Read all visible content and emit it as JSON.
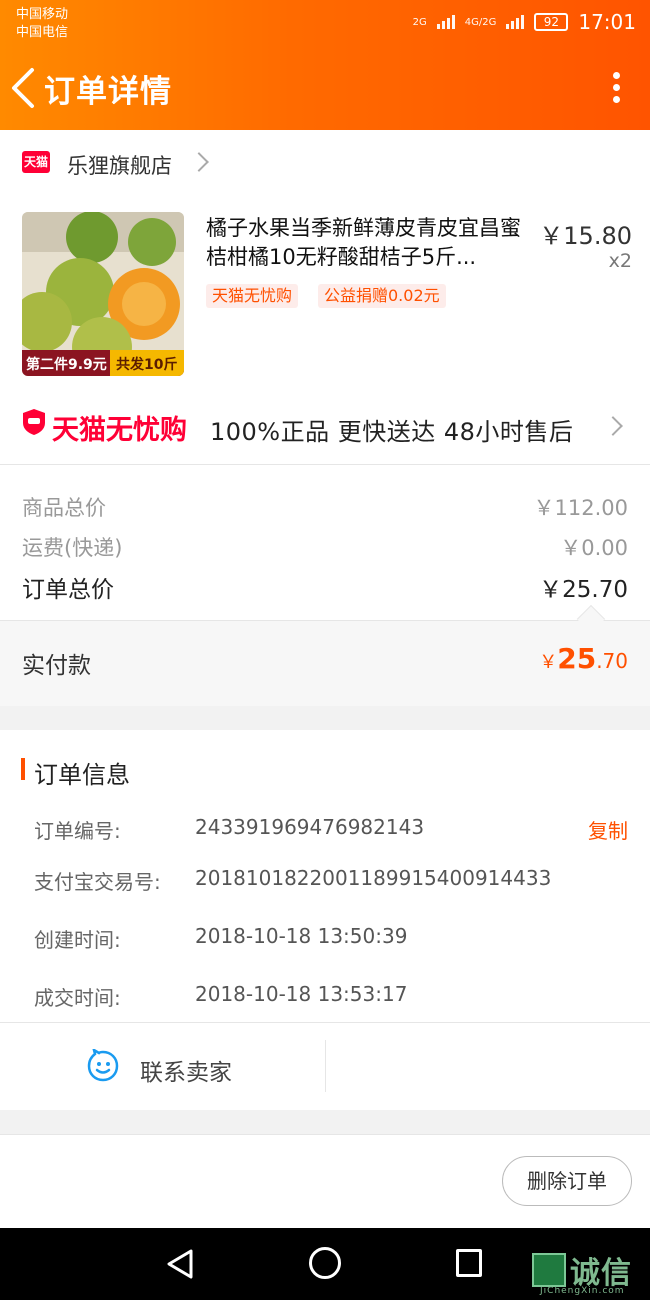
{
  "status": {
    "carrier1": "中国移动",
    "carrier2": "中国电信",
    "net1": "2G",
    "net2": "4G/2G",
    "battery": "92",
    "time": "17:01"
  },
  "header": {
    "title": "订单详情"
  },
  "shop": {
    "badge": "天猫",
    "name": "乐狸旗舰店"
  },
  "product": {
    "title": "橘子水果当季新鲜薄皮青皮宜昌蜜桔柑橘10无籽酸甜桔子5斤...",
    "price": "￥15.80",
    "qty": "x2",
    "tag1": "天猫无忧购",
    "tag2": "公益捐赠0.02元",
    "image_banner_left": "第二件9.9元",
    "image_banner_right": "共发10斤"
  },
  "assurance": {
    "brand": "天猫无忧购",
    "items": "100%正品  更快送达  48小时售后"
  },
  "totals": {
    "goods_label": "商品总价",
    "goods_value": "￥112.00",
    "shipping_label": "运费(快递)",
    "shipping_value": "￥0.00",
    "order_label": "订单总价",
    "order_value": "￥25.70",
    "paid_label": "实付款",
    "paid_yen": "￥",
    "paid_int": "25",
    "paid_dec": ".70"
  },
  "order_info": {
    "title": "订单信息",
    "order_no_label": "订单编号:",
    "order_no": "243391969476982143",
    "copy": "复制",
    "alipay_label": "支付宝交易号:",
    "alipay_no": "2018101822001189915400914433",
    "created_label": "创建时间:",
    "created": "2018-10-18 13:50:39",
    "closed_label": "成交时间:",
    "closed": "2018-10-18 13:53:17"
  },
  "contact": {
    "label": "联系卖家"
  },
  "actions": {
    "delete": "删除订单"
  },
  "watermark": {
    "text": "诚信",
    "sub": "JiChengXin.com"
  },
  "colors": {
    "accent": "#ff5000",
    "tmall_red": "#ff0036",
    "header_start": "#ff8a00",
    "header_end": "#ff5400"
  }
}
